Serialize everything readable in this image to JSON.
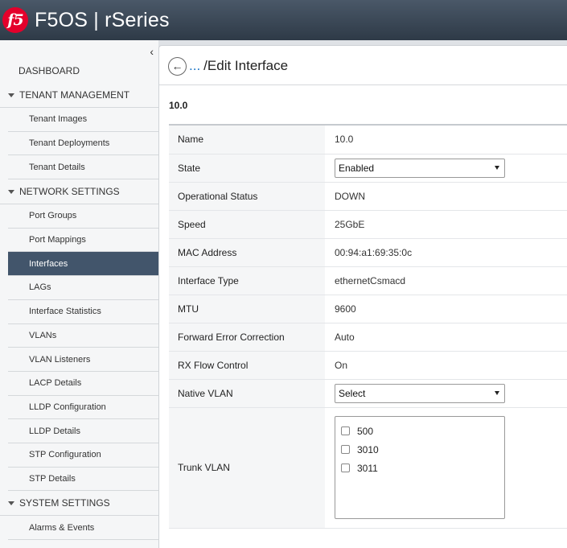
{
  "header": {
    "logo_text": "f5",
    "title": "F5OS | rSeries"
  },
  "sidebar": {
    "collapse_glyph": "‹",
    "dashboard": "DASHBOARD",
    "sections": [
      {
        "label": "TENANT MANAGEMENT",
        "items": [
          "Tenant Images",
          "Tenant Deployments",
          "Tenant Details"
        ]
      },
      {
        "label": "NETWORK SETTINGS",
        "items": [
          "Port Groups",
          "Port Mappings",
          "Interfaces",
          "LAGs",
          "Interface Statistics",
          "VLANs",
          "VLAN Listeners",
          "LACP Details",
          "LLDP Configuration",
          "LLDP Details",
          "STP Configuration",
          "STP Details"
        ]
      },
      {
        "label": "SYSTEM SETTINGS",
        "items": [
          "Alarms & Events"
        ]
      }
    ],
    "active_item": "Interfaces"
  },
  "breadcrumb": {
    "back_glyph": "←",
    "ellipsis": "...",
    "title": "/Edit Interface"
  },
  "interface": {
    "id": "10.0",
    "fields": {
      "name_label": "Name",
      "name_value": "10.0",
      "state_label": "State",
      "state_value": "Enabled",
      "opstatus_label": "Operational Status",
      "opstatus_value": "DOWN",
      "speed_label": "Speed",
      "speed_value": "25GbE",
      "mac_label": "MAC Address",
      "mac_value": "00:94:a1:69:35:0c",
      "type_label": "Interface Type",
      "type_value": "ethernetCsmacd",
      "mtu_label": "MTU",
      "mtu_value": "9600",
      "fec_label": "Forward Error Correction",
      "fec_value": "Auto",
      "rxflow_label": "RX Flow Control",
      "rxflow_value": "On",
      "native_label": "Native VLAN",
      "native_value": "Select",
      "trunk_label": "Trunk VLAN",
      "trunk_options": [
        "500",
        "3010",
        "3011"
      ]
    }
  },
  "colors": {
    "header_bg": "#3a4756",
    "active_nav_bg": "#42556b",
    "logo_red": "#e4002b",
    "link_blue": "#1a74c5"
  }
}
